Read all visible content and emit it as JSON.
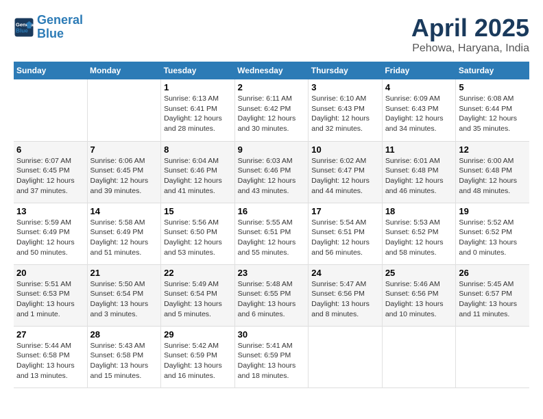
{
  "logo": {
    "line1": "General",
    "line2": "Blue"
  },
  "title": "April 2025",
  "subtitle": "Pehowa, Haryana, India",
  "weekdays": [
    "Sunday",
    "Monday",
    "Tuesday",
    "Wednesday",
    "Thursday",
    "Friday",
    "Saturday"
  ],
  "weeks": [
    [
      {
        "day": "",
        "info": ""
      },
      {
        "day": "",
        "info": ""
      },
      {
        "day": "1",
        "info": "Sunrise: 6:13 AM\nSunset: 6:41 PM\nDaylight: 12 hours\nand 28 minutes."
      },
      {
        "day": "2",
        "info": "Sunrise: 6:11 AM\nSunset: 6:42 PM\nDaylight: 12 hours\nand 30 minutes."
      },
      {
        "day": "3",
        "info": "Sunrise: 6:10 AM\nSunset: 6:43 PM\nDaylight: 12 hours\nand 32 minutes."
      },
      {
        "day": "4",
        "info": "Sunrise: 6:09 AM\nSunset: 6:43 PM\nDaylight: 12 hours\nand 34 minutes."
      },
      {
        "day": "5",
        "info": "Sunrise: 6:08 AM\nSunset: 6:44 PM\nDaylight: 12 hours\nand 35 minutes."
      }
    ],
    [
      {
        "day": "6",
        "info": "Sunrise: 6:07 AM\nSunset: 6:45 PM\nDaylight: 12 hours\nand 37 minutes."
      },
      {
        "day": "7",
        "info": "Sunrise: 6:06 AM\nSunset: 6:45 PM\nDaylight: 12 hours\nand 39 minutes."
      },
      {
        "day": "8",
        "info": "Sunrise: 6:04 AM\nSunset: 6:46 PM\nDaylight: 12 hours\nand 41 minutes."
      },
      {
        "day": "9",
        "info": "Sunrise: 6:03 AM\nSunset: 6:46 PM\nDaylight: 12 hours\nand 43 minutes."
      },
      {
        "day": "10",
        "info": "Sunrise: 6:02 AM\nSunset: 6:47 PM\nDaylight: 12 hours\nand 44 minutes."
      },
      {
        "day": "11",
        "info": "Sunrise: 6:01 AM\nSunset: 6:48 PM\nDaylight: 12 hours\nand 46 minutes."
      },
      {
        "day": "12",
        "info": "Sunrise: 6:00 AM\nSunset: 6:48 PM\nDaylight: 12 hours\nand 48 minutes."
      }
    ],
    [
      {
        "day": "13",
        "info": "Sunrise: 5:59 AM\nSunset: 6:49 PM\nDaylight: 12 hours\nand 50 minutes."
      },
      {
        "day": "14",
        "info": "Sunrise: 5:58 AM\nSunset: 6:49 PM\nDaylight: 12 hours\nand 51 minutes."
      },
      {
        "day": "15",
        "info": "Sunrise: 5:56 AM\nSunset: 6:50 PM\nDaylight: 12 hours\nand 53 minutes."
      },
      {
        "day": "16",
        "info": "Sunrise: 5:55 AM\nSunset: 6:51 PM\nDaylight: 12 hours\nand 55 minutes."
      },
      {
        "day": "17",
        "info": "Sunrise: 5:54 AM\nSunset: 6:51 PM\nDaylight: 12 hours\nand 56 minutes."
      },
      {
        "day": "18",
        "info": "Sunrise: 5:53 AM\nSunset: 6:52 PM\nDaylight: 12 hours\nand 58 minutes."
      },
      {
        "day": "19",
        "info": "Sunrise: 5:52 AM\nSunset: 6:52 PM\nDaylight: 13 hours\nand 0 minutes."
      }
    ],
    [
      {
        "day": "20",
        "info": "Sunrise: 5:51 AM\nSunset: 6:53 PM\nDaylight: 13 hours\nand 1 minute."
      },
      {
        "day": "21",
        "info": "Sunrise: 5:50 AM\nSunset: 6:54 PM\nDaylight: 13 hours\nand 3 minutes."
      },
      {
        "day": "22",
        "info": "Sunrise: 5:49 AM\nSunset: 6:54 PM\nDaylight: 13 hours\nand 5 minutes."
      },
      {
        "day": "23",
        "info": "Sunrise: 5:48 AM\nSunset: 6:55 PM\nDaylight: 13 hours\nand 6 minutes."
      },
      {
        "day": "24",
        "info": "Sunrise: 5:47 AM\nSunset: 6:56 PM\nDaylight: 13 hours\nand 8 minutes."
      },
      {
        "day": "25",
        "info": "Sunrise: 5:46 AM\nSunset: 6:56 PM\nDaylight: 13 hours\nand 10 minutes."
      },
      {
        "day": "26",
        "info": "Sunrise: 5:45 AM\nSunset: 6:57 PM\nDaylight: 13 hours\nand 11 minutes."
      }
    ],
    [
      {
        "day": "27",
        "info": "Sunrise: 5:44 AM\nSunset: 6:58 PM\nDaylight: 13 hours\nand 13 minutes."
      },
      {
        "day": "28",
        "info": "Sunrise: 5:43 AM\nSunset: 6:58 PM\nDaylight: 13 hours\nand 15 minutes."
      },
      {
        "day": "29",
        "info": "Sunrise: 5:42 AM\nSunset: 6:59 PM\nDaylight: 13 hours\nand 16 minutes."
      },
      {
        "day": "30",
        "info": "Sunrise: 5:41 AM\nSunset: 6:59 PM\nDaylight: 13 hours\nand 18 minutes."
      },
      {
        "day": "",
        "info": ""
      },
      {
        "day": "",
        "info": ""
      },
      {
        "day": "",
        "info": ""
      }
    ]
  ]
}
